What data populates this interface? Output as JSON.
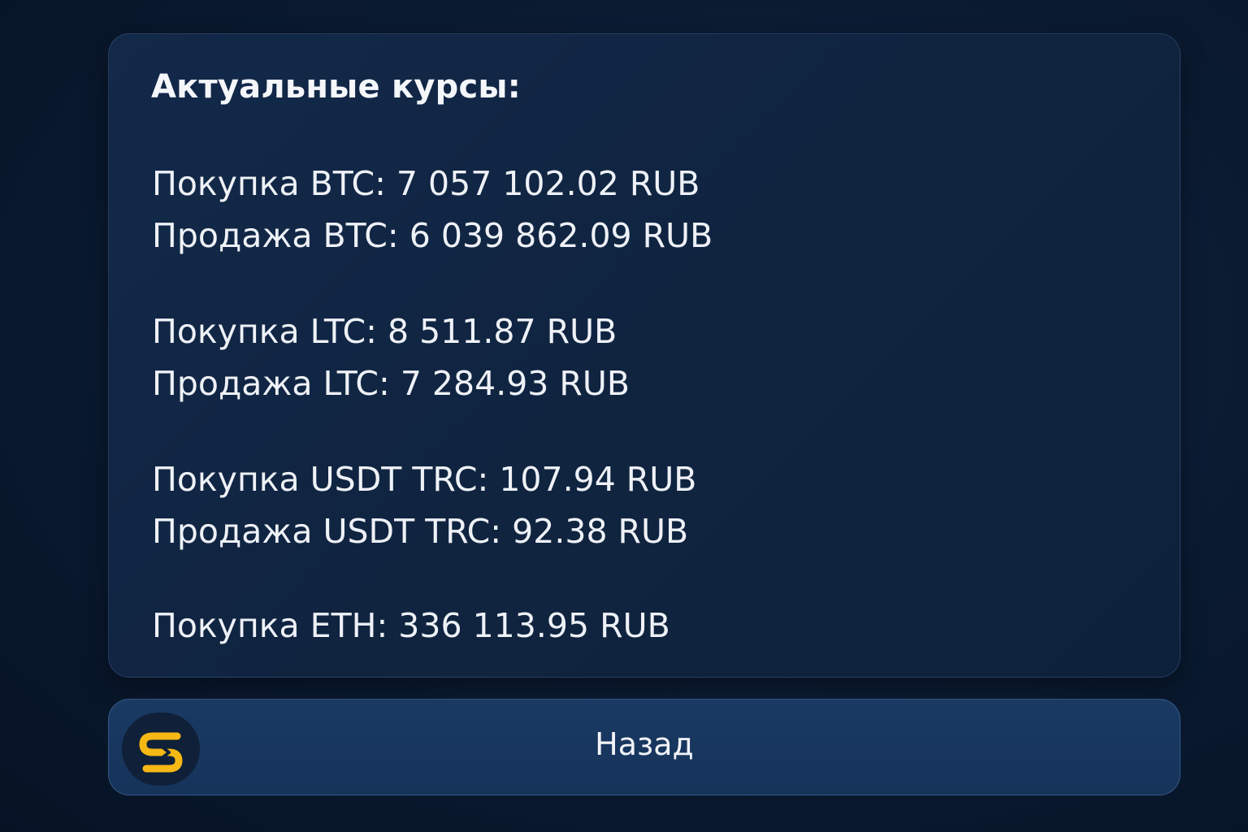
{
  "message": {
    "title": "Актуальные курсы:",
    "lines": [
      "Покупка BTC: 7 057 102.02 RUB",
      "Продажа BTC: 6 039 862.09 RUB",
      "Покупка LTC: 8 511.87 RUB",
      "Продажа LTC: 7 284.93 RUB",
      "Покупка USDT TRC: 107.94 RUB",
      "Продажа USDT TRC: 92.38 RUB",
      "Покупка ETH: 336 113.95 RUB"
    ]
  },
  "button": {
    "label": "Назад",
    "icon": "exchange-logo-icon",
    "icon_color": "#f5b814"
  },
  "colors": {
    "background": "#0a1a30",
    "card": "#11264a",
    "button": "#183760",
    "text": "#eef1f6"
  }
}
